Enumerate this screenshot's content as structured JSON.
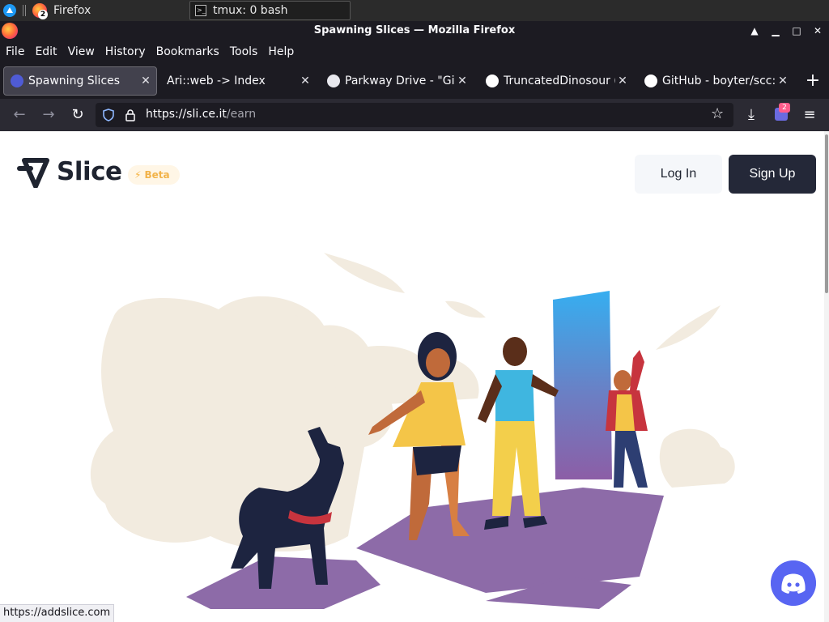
{
  "taskbar": {
    "firefox_label": "Firefox",
    "firefox_badge": "2",
    "tmux_label": "tmux: 0 bash"
  },
  "window": {
    "title": "Spawning Slices — Mozilla Firefox"
  },
  "menu": [
    "File",
    "Edit",
    "View",
    "History",
    "Bookmarks",
    "Tools",
    "Help"
  ],
  "tabs": [
    {
      "title": "Spawning Slices"
    },
    {
      "title": "Ari::web -> Index"
    },
    {
      "title": "Parkway Drive - \"Gin"
    },
    {
      "title": "TruncatedDinosour (T"
    },
    {
      "title": "GitHub - boyter/scc:"
    }
  ],
  "urlbar": {
    "host": "https://sli.ce.it",
    "path": "/earn"
  },
  "extensions": {
    "badge_count": "2"
  },
  "site": {
    "brand": "Slice",
    "beta_label": "Beta",
    "login_label": "Log In",
    "signup_label": "Sign Up"
  },
  "status": {
    "link": "https://addslice.com"
  },
  "colors": {
    "brand_dark": "#242838",
    "beta_text": "#f2b34a",
    "discord": "#5865f2",
    "portal_top": "#3aa7e6",
    "portal_bottom": "#8a5aa0",
    "floor": "#8d6ba8"
  }
}
